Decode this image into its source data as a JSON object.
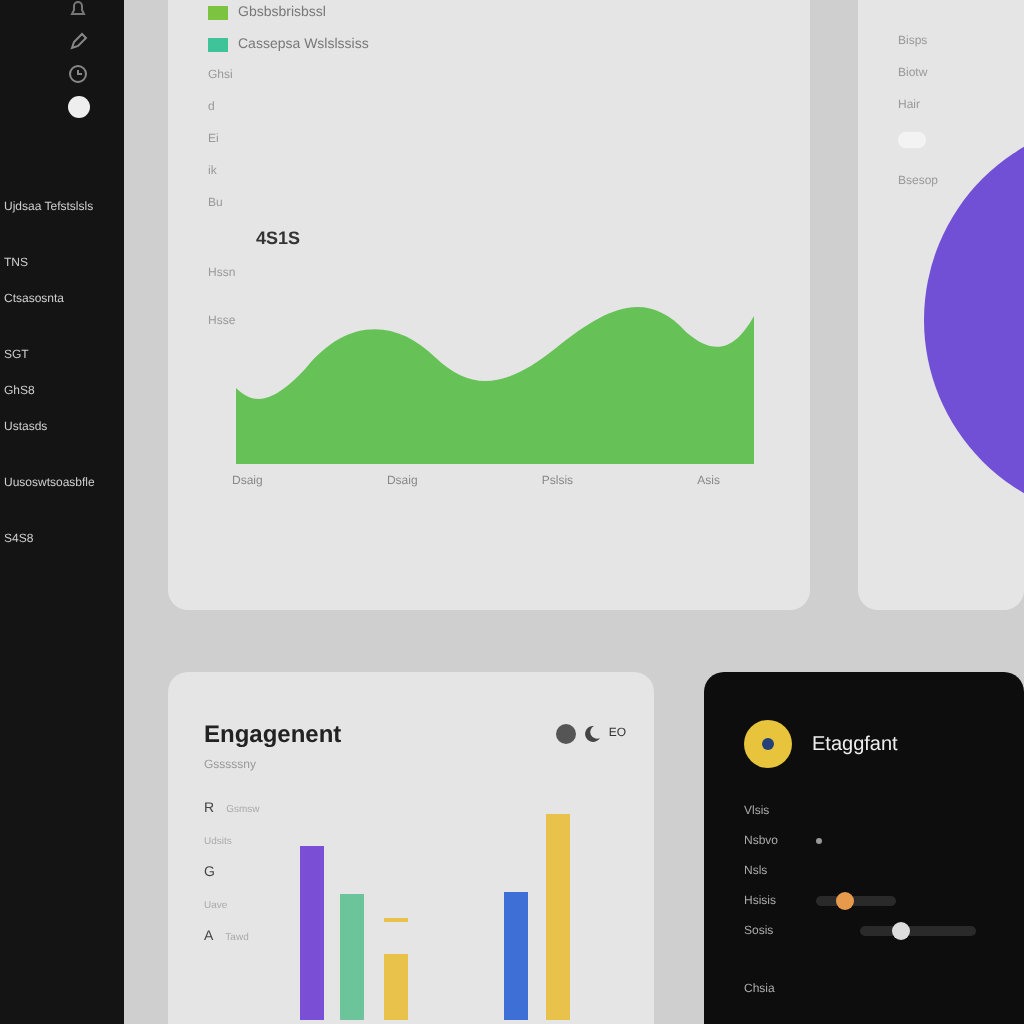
{
  "sidebar": {
    "items": [
      {
        "label": "Ujdsaa Tefstslsls",
        "selected": false
      },
      {
        "label": "TNS",
        "selected": false
      },
      {
        "label": "Ctsasosnta",
        "selected": false
      },
      {
        "label": "SGT",
        "selected": false
      },
      {
        "label": "GhS8",
        "selected": false
      },
      {
        "label": "Ustasds",
        "selected": false
      },
      {
        "label": "Uusoswtsoasbfle",
        "selected": false
      },
      {
        "label": "S4S8",
        "selected": false
      }
    ]
  },
  "trend_card": {
    "legend": [
      {
        "label": "Gbsbsbrisbssl",
        "color": "#7cc43f"
      },
      {
        "label": "Cassepsa Wslslssiss",
        "color": "#3fc49a"
      }
    ],
    "side_labels": [
      "Ghsi",
      "d",
      "Ei",
      "ik",
      "Bu"
    ],
    "value": "4S1S",
    "y_labels": [
      "Hssn",
      "Hsse"
    ],
    "x_labels": [
      "Dsaig",
      "Dsaig",
      "Pslsis",
      "Asis"
    ]
  },
  "share_card": {
    "labels": [
      "Bisps",
      "Biotw",
      "Hair"
    ],
    "toggle": {
      "on": false
    },
    "footer": "Bsesop"
  },
  "engagement_card": {
    "title": "Engagenent",
    "subtitle": "Gsssssny",
    "badge": "EO",
    "axis": [
      {
        "mark": "R",
        "label": "Gsmsw"
      },
      {
        "label": "Udsits"
      },
      {
        "mark": "G"
      },
      {
        "label": "Uave"
      },
      {
        "mark": "A",
        "label": "Tawd"
      }
    ]
  },
  "settings_card": {
    "title": "Etaggfant",
    "rows": [
      {
        "kind": "text",
        "label": "Vlsis"
      },
      {
        "kind": "dot",
        "label": "Nsbvo"
      },
      {
        "kind": "text",
        "label": "Nsls"
      },
      {
        "kind": "slider",
        "label": "Hsisis",
        "level": 0.35,
        "color": "#e89a4c"
      },
      {
        "kind": "slider",
        "label": "Sosis",
        "level": 0.35,
        "color": "#dddddd"
      },
      {
        "kind": "text",
        "label": "Chsia"
      }
    ]
  }
}
